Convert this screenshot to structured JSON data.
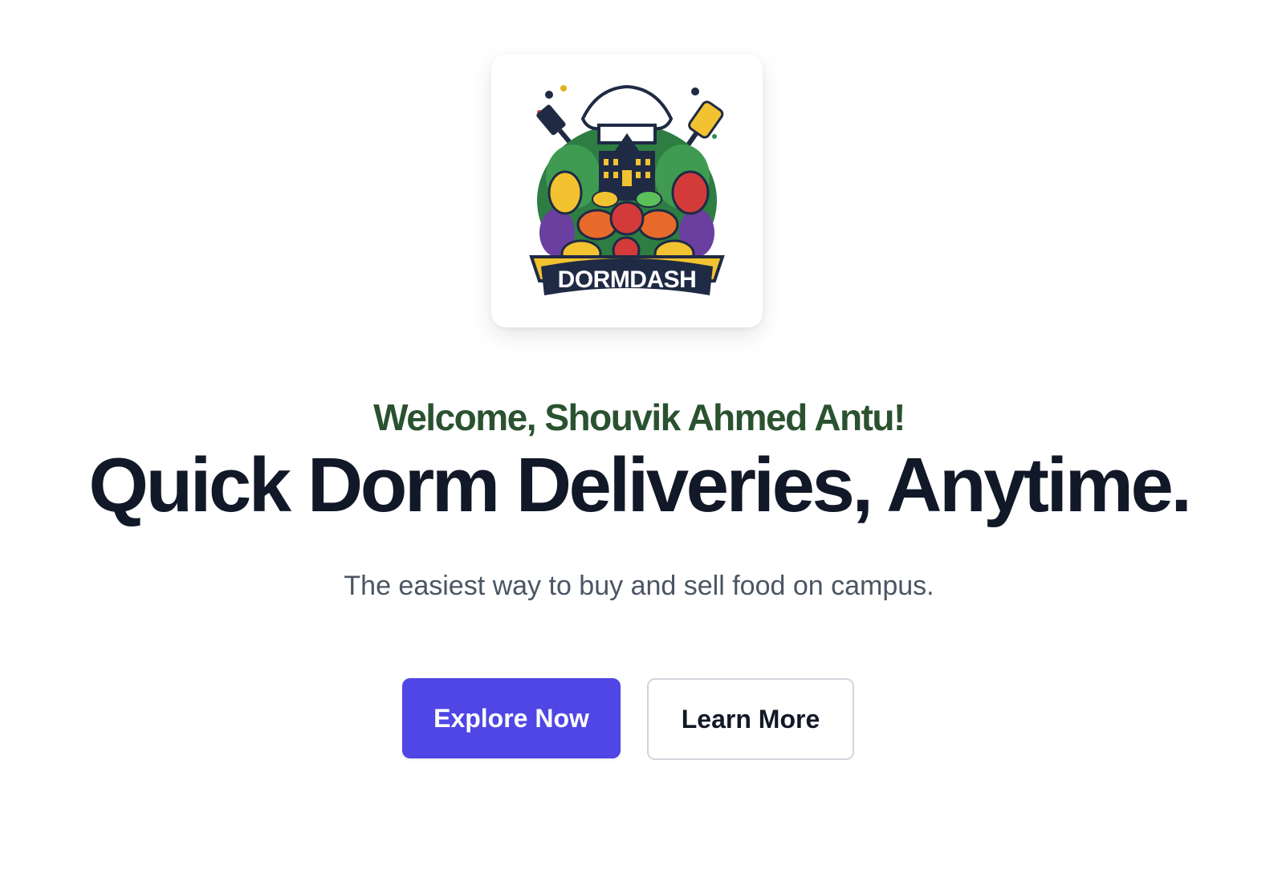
{
  "logo": {
    "icon": "dormdash-logo",
    "wordmark": "DORMDASH"
  },
  "hero": {
    "welcome": "Welcome, Shouvik Ahmed Antu!",
    "headline": "Quick Dorm Deliveries, Anytime.",
    "subtitle": "The easiest way to buy and sell food on campus."
  },
  "actions": {
    "primary_label": "Explore Now",
    "secondary_label": "Learn More"
  },
  "colors": {
    "welcome": "#2a5230",
    "headline": "#111827",
    "subtitle": "#4b5563",
    "primary_button": "#4f46e5"
  }
}
